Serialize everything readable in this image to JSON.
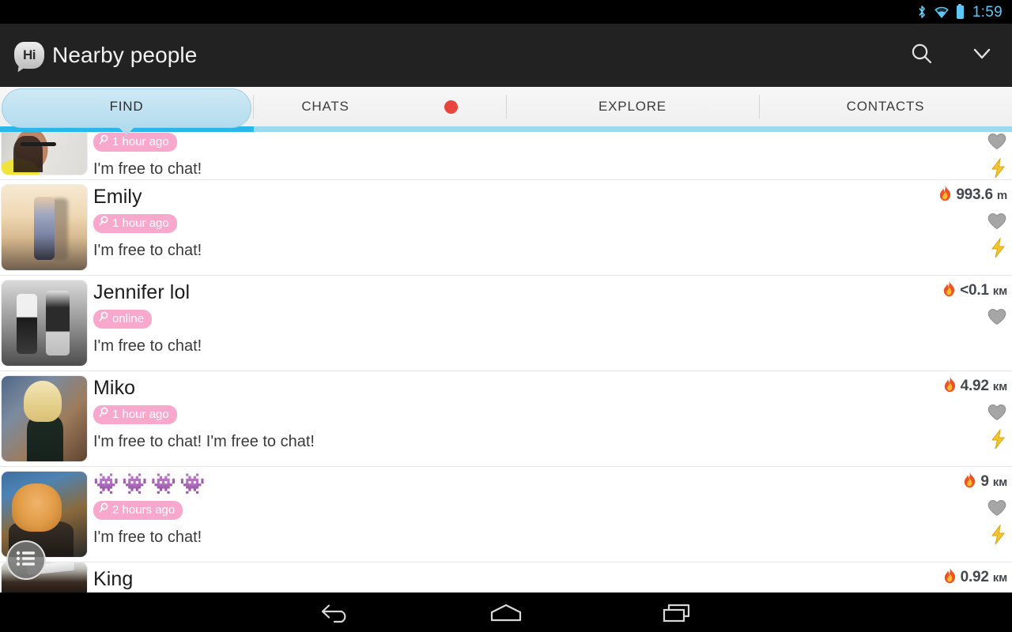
{
  "status_bar": {
    "time": "1:59",
    "icons": [
      "bluetooth-icon",
      "wifi-icon",
      "battery-icon"
    ]
  },
  "app_bar": {
    "logo_text": "Hi",
    "title": "Nearby people",
    "actions": [
      {
        "name": "search-icon",
        "label": "Search"
      },
      {
        "name": "chevron-down-icon",
        "label": "More"
      }
    ]
  },
  "tabs": {
    "items": [
      {
        "label": "FIND",
        "active": true,
        "badge": false
      },
      {
        "label": "CHATS",
        "active": false,
        "badge": true
      },
      {
        "label": "EXPLORE",
        "active": false,
        "badge": false
      },
      {
        "label": "CONTACTS",
        "active": false,
        "badge": false
      }
    ],
    "active_color": "#b3dcee",
    "underline_color": "#29b6e8",
    "badge_color": "#e8453c"
  },
  "list": {
    "rows": [
      {
        "name": "",
        "status": "1 hour ago",
        "message": "I'm free to chat!",
        "distance": "",
        "distance_unit": "",
        "has_heart": true,
        "has_bolt": true,
        "partial": "top",
        "avatar": "av1"
      },
      {
        "name": "Emily",
        "status": "1 hour ago",
        "message": "I'm free to chat!",
        "distance": "993.6",
        "distance_unit": "m",
        "has_heart": true,
        "has_bolt": true,
        "partial": "",
        "avatar": "av2"
      },
      {
        "name": "Jennifer lol",
        "status": "online",
        "message": "I'm free to chat!",
        "distance": "<0.1",
        "distance_unit": "км",
        "has_heart": true,
        "has_bolt": false,
        "partial": "",
        "avatar": "av3"
      },
      {
        "name": "Miko",
        "status": "1 hour ago",
        "message": "I'm free to chat! I'm free to chat!",
        "distance": "4.92",
        "distance_unit": "км",
        "has_heart": true,
        "has_bolt": true,
        "partial": "",
        "avatar": "av4"
      },
      {
        "name": "👾👾👾👾",
        "status": "2 hours ago",
        "message": "I'm free to chat!",
        "distance": "9",
        "distance_unit": "км",
        "has_heart": true,
        "has_bolt": true,
        "partial": "",
        "avatar": "av5"
      },
      {
        "name": "King",
        "status": "",
        "message": "",
        "distance": "0.92",
        "distance_unit": "км",
        "has_heart": false,
        "has_bolt": false,
        "partial": "bottom",
        "avatar": "av6"
      }
    ],
    "badge_color": "#f8a8cd",
    "flame_color": "#ef5223",
    "heart_color": "#9e9e9e",
    "bolt_color": "#f5c62b"
  },
  "fab": {
    "name": "list-view-button",
    "label": "List view"
  },
  "nav_bar": {
    "buttons": [
      {
        "name": "nav-back-button",
        "label": "Back"
      },
      {
        "name": "nav-home-button",
        "label": "Home"
      },
      {
        "name": "nav-recents-button",
        "label": "Recents"
      }
    ]
  }
}
